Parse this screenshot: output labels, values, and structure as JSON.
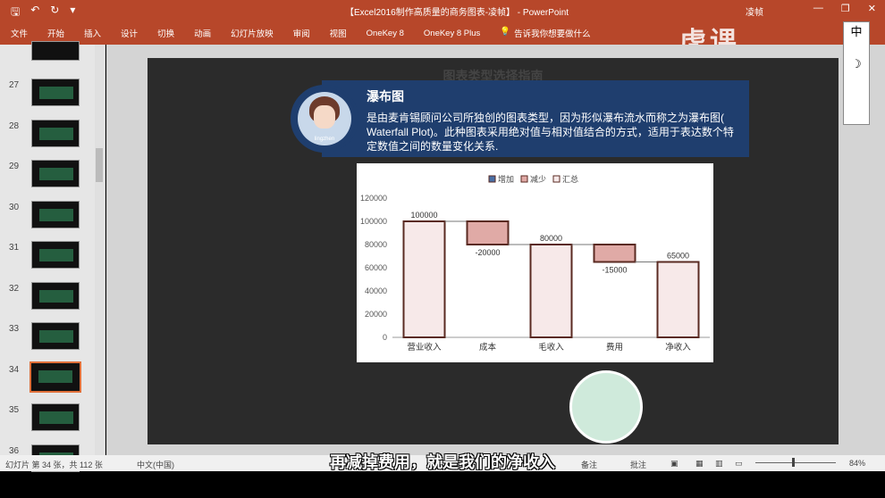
{
  "titlebar": {
    "doc_title": "【Excel2016制作高质量的商务图表-凌帧】 - PowerPoint",
    "user": "凌帧"
  },
  "ribbon": {
    "tabs": [
      "文件",
      "开始",
      "插入",
      "设计",
      "切换",
      "动画",
      "幻灯片放映",
      "审阅",
      "视图",
      "OneKey 8",
      "OneKey 8 Plus"
    ],
    "tell_me": "告诉我你想要做什么"
  },
  "thumbnails": [
    {
      "num": "27"
    },
    {
      "num": "28"
    },
    {
      "num": "29"
    },
    {
      "num": "30"
    },
    {
      "num": "31"
    },
    {
      "num": "32"
    },
    {
      "num": "33"
    },
    {
      "num": "34",
      "selected": true
    },
    {
      "num": "35"
    },
    {
      "num": "36"
    }
  ],
  "slide": {
    "title": "图表类型选择指南"
  },
  "callout": {
    "title": "瀑布图",
    "body": "是由麦肯锡顾问公司所独创的图表类型，因为形似瀑布流水而称之为瀑布图( Waterfall Plot)。此种图表采用绝对值与相对值结合的方式，适用于表达数个特定数值之间的数量变化关系.",
    "avatar_name": "lingzhen"
  },
  "chart_data": {
    "type": "bar",
    "subtype": "waterfall",
    "legend": [
      "增加",
      "减少",
      "汇总"
    ],
    "legend_position": "top",
    "categories": [
      "营业收入",
      "成本",
      "毛收入",
      "费用",
      "净收入"
    ],
    "values": [
      100000,
      -20000,
      80000,
      -15000,
      65000
    ],
    "kinds": [
      "total",
      "decrease",
      "total",
      "decrease",
      "total"
    ],
    "labels": [
      "100000",
      "-20000",
      "80000",
      "-15000",
      "65000"
    ],
    "yticks": [
      0,
      20000,
      40000,
      60000,
      80000,
      100000,
      120000
    ],
    "ylim": [
      0,
      120000
    ],
    "colors": {
      "total": "#f7e9e9",
      "decrease": "#e0aaa6",
      "increase": "#4a6fa5",
      "edge": "#5a2a22"
    }
  },
  "statusbar": {
    "slide_info": "幻灯片 第 34 张，共 112 张",
    "language": "中文(中国)",
    "notes": "备注",
    "comments": "批注",
    "zoom": "84%"
  },
  "subtitle": "再减掉费用，就是我们的净收入",
  "watermark": "虎课网",
  "ime": "中"
}
